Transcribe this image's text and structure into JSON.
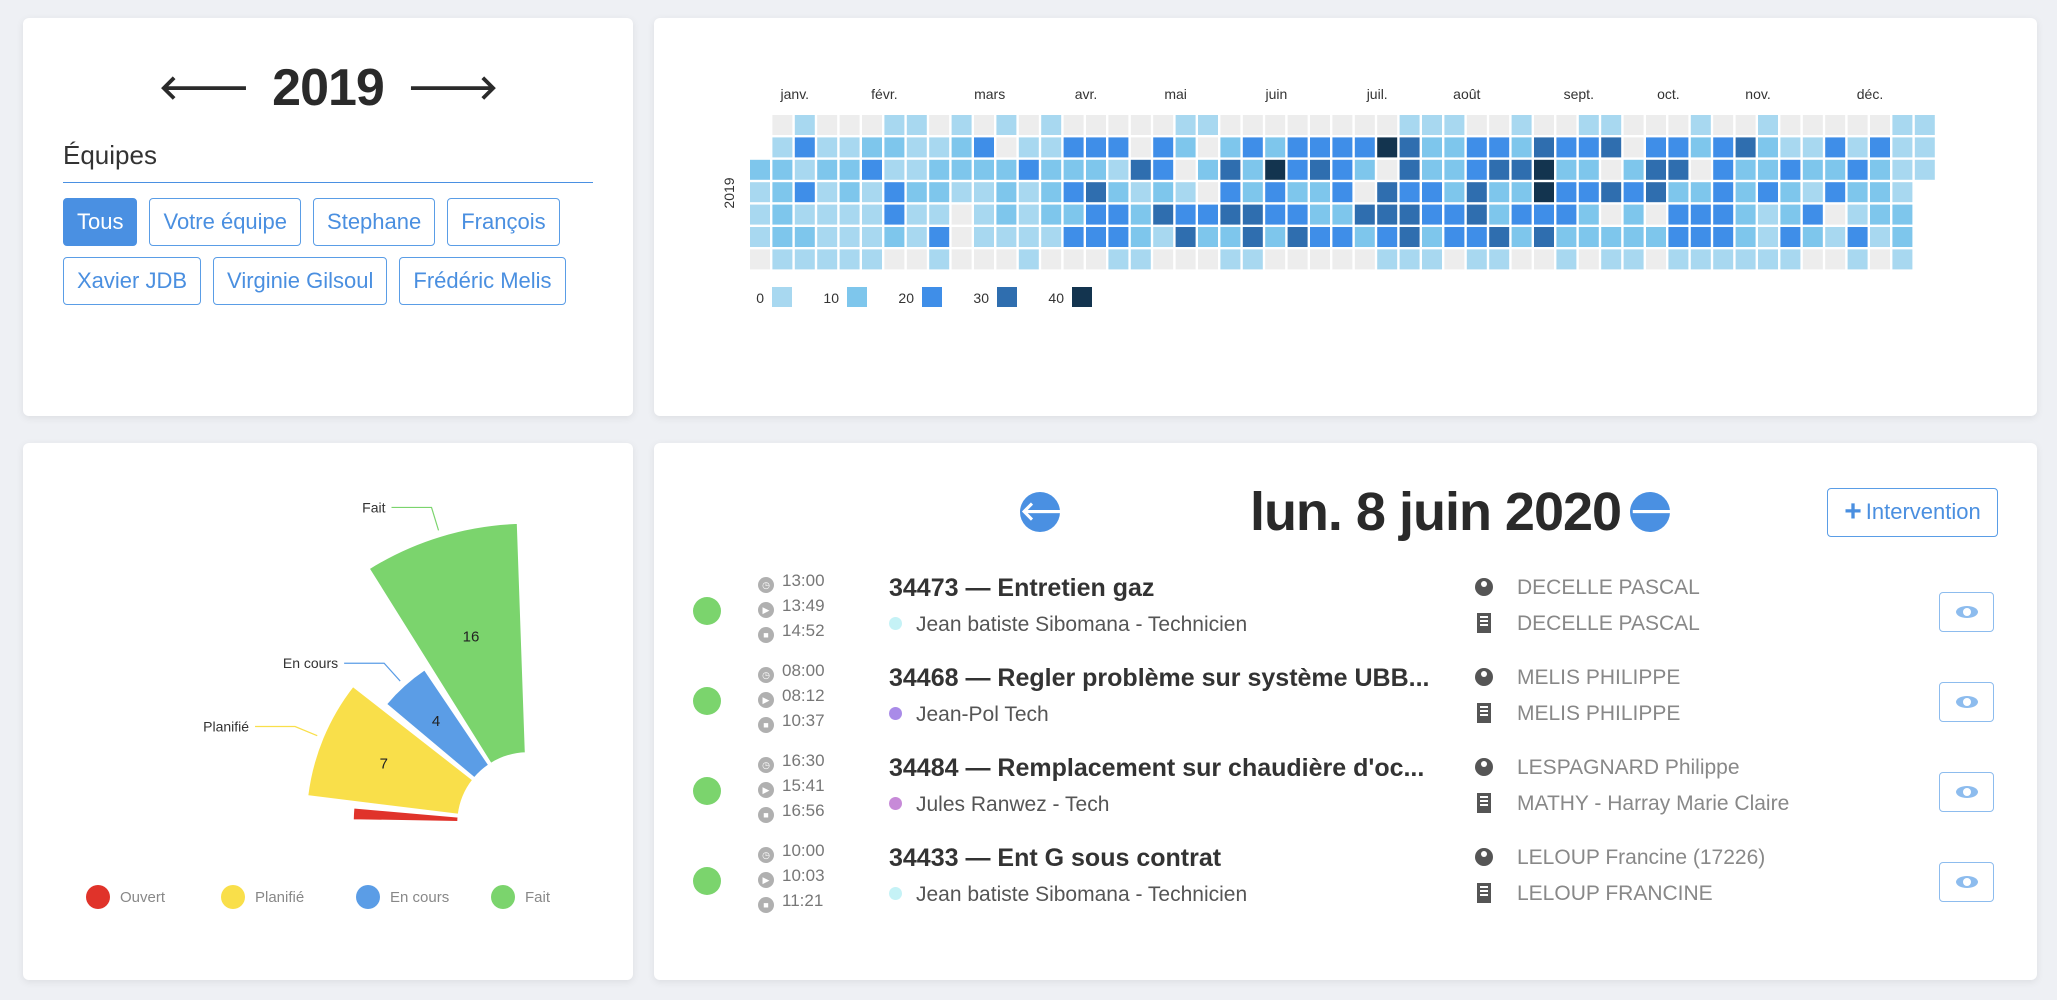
{
  "year_panel": {
    "year": "2019",
    "prev_arrow": "🡐",
    "next_arrow": "🡒",
    "teams_title": "Équipes",
    "teams": [
      "Tous",
      "Votre équipe",
      "Stephane",
      "François",
      "Xavier JDB",
      "Virginie Gilsoul",
      "Frédéric Melis"
    ],
    "active_team": "Tous"
  },
  "heatmap": {
    "year_label": "2019",
    "months": [
      "janv.",
      "févr.",
      "mars",
      "avr.",
      "mai",
      "juin",
      "juil.",
      "août",
      "sept.",
      "oct.",
      "nov.",
      "déc."
    ],
    "legend": [
      {
        "label": "0",
        "color": "#a8d8f0"
      },
      {
        "label": "10",
        "color": "#7ec6ec"
      },
      {
        "label": "20",
        "color": "#3f8ee8"
      },
      {
        "label": "30",
        "color": "#2f6eaf"
      },
      {
        "label": "40",
        "color": "#13344f"
      }
    ],
    "empty_color": "#ededed"
  },
  "chart_data": {
    "type": "pie",
    "categories": [
      "Ouvert",
      "Planifié",
      "En cours",
      "Fait"
    ],
    "values": [
      0.3,
      7,
      4,
      16
    ],
    "data_labels": [
      "",
      "7",
      "4",
      "16"
    ],
    "colors": [
      "#e0332a",
      "#f9df4a",
      "#5b9de6",
      "#7bd46d"
    ],
    "legend_position": "bottom"
  },
  "day_panel": {
    "title": "lun. 8 juin 2020",
    "prev_icon": "🡐",
    "next_icon": "🡒",
    "add_label": "Intervention",
    "add_icon": "+",
    "status_color": "#7bd46d",
    "rows": [
      {
        "times": [
          "13:00",
          "13:49",
          "14:52"
        ],
        "title": "34473 — Entretien gaz",
        "tech": "Jean batiste Sibomana - Technicien",
        "tech_color": "#c5f2f6",
        "client": "DECELLE PASCAL",
        "site": "DECELLE PASCAL"
      },
      {
        "times": [
          "08:00",
          "08:12",
          "10:37"
        ],
        "title": "34468 — Regler problème sur système UBB...",
        "tech": "Jean-Pol Tech",
        "tech_color": "#a98be8",
        "client": "MELIS PHILIPPE",
        "site": "MELIS PHILIPPE"
      },
      {
        "times": [
          "16:30",
          "15:41",
          "16:56"
        ],
        "title": "34484 — Remplacement sur chaudière d'oc...",
        "tech": "Jules Ranwez - Tech",
        "tech_color": "#c78ad8",
        "client": "LESPAGNARD Philippe",
        "site": "MATHY - Harray Marie Claire"
      },
      {
        "times": [
          "10:00",
          "10:03",
          "11:21"
        ],
        "title": "34433 — Ent G sous contrat",
        "tech": "Jean batiste Sibomana - Technicien",
        "tech_color": "#c5f2f6",
        "client": "LELOUP Francine (17226)",
        "site": "LELOUP FRANCINE"
      }
    ]
  }
}
